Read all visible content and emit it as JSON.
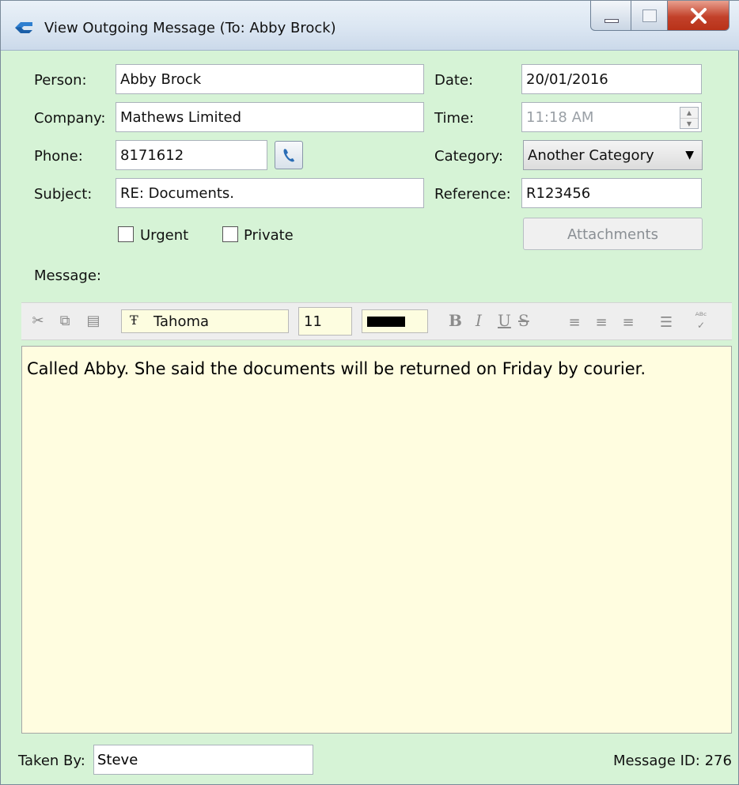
{
  "window": {
    "title": "View Outgoing Message (To: Abby Brock)"
  },
  "form": {
    "person_label": "Person:",
    "person_value": "Abby Brock",
    "company_label": "Company:",
    "company_value": "Mathews Limited",
    "phone_label": "Phone:",
    "phone_value": "8171612",
    "subject_label": "Subject:",
    "subject_value": "RE: Documents.",
    "date_label": "Date:",
    "date_value": "20/01/2016",
    "time_label": "Time:",
    "time_value": "11:18 AM",
    "category_label": "Category:",
    "category_value": "Another Category",
    "reference_label": "Reference:",
    "reference_value": "R123456",
    "urgent_label": "Urgent",
    "private_label": "Private",
    "attachments_label": "Attachments",
    "message_label": "Message:"
  },
  "toolbar": {
    "font_name": "Tahoma",
    "font_size": "11",
    "text_color": "#000000",
    "icons": [
      "cut-icon",
      "copy-icon",
      "paste-icon",
      "bold-icon",
      "italic-icon",
      "underline-icon",
      "strikethrough-icon",
      "align-left-icon",
      "align-center-icon",
      "align-right-icon",
      "bullet-list-icon",
      "spellcheck-icon"
    ]
  },
  "message": {
    "text": "Called Abby.  She said the documents will be returned on Friday by courier."
  },
  "footer": {
    "taken_by_label": "Taken By:",
    "taken_by_value": "Steve",
    "message_id": "Message ID: 276"
  },
  "colors": {
    "window_bg": "#d6f3d6",
    "editor_bg": "#fffde0",
    "close_button": "#c2412a"
  }
}
